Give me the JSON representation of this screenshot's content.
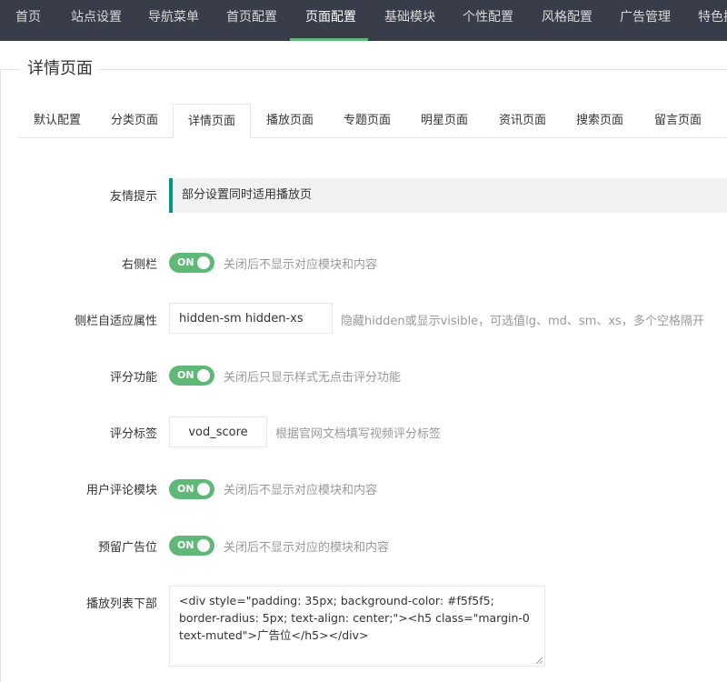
{
  "topnav": {
    "items": [
      "首页",
      "站点设置",
      "导航菜单",
      "首页配置",
      "页面配置",
      "基础模块",
      "个性配置",
      "风格配置",
      "广告管理",
      "特色插件"
    ],
    "active_index": 4,
    "active_color": "#5fb878"
  },
  "section": {
    "legend": "详情页面"
  },
  "tabs": {
    "items": [
      "默认配置",
      "分类页面",
      "详情页面",
      "播放页面",
      "专题页面",
      "明星页面",
      "资讯页面",
      "搜索页面",
      "留言页面"
    ],
    "active_index": 2
  },
  "form": {
    "tip": {
      "label": "友情提示",
      "text": "部分设置同时适用播放页",
      "accent": "#009688"
    },
    "right_sidebar": {
      "label": "右侧栏",
      "switch": "ON",
      "hint": "关闭后不显示对应模块和内容"
    },
    "sidebar_responsive": {
      "label": "侧栏自适应属性",
      "value": "hidden-sm hidden-xs",
      "hint": "隐藏hidden或显示visible，可选值lg、md、sm、xs，多个空格隔开"
    },
    "rating": {
      "label": "评分功能",
      "switch": "ON",
      "hint": "关闭后只显示样式无点击评分功能"
    },
    "rating_tag": {
      "label": "评分标签",
      "value": "vod_score",
      "hint": "根据官网文档填写视频评分标签"
    },
    "comments": {
      "label": "用户评论模块",
      "switch": "ON",
      "hint": "关闭后不显示对应模块和内容"
    },
    "reserved_ad": {
      "label": "预留广告位",
      "switch": "ON",
      "hint": "关闭后不显示对应的模块和内容"
    },
    "playlist_bottom": {
      "label": "播放列表下部",
      "value": "<div style=\"padding: 35px; background-color: #f5f5f5; border-radius: 5px; text-align: center;\"><h5 class=\"margin-0 text-muted\">广告位</h5></div>"
    }
  },
  "colors": {
    "switch_on": "#5fb878",
    "nav_bg": "#393d49"
  },
  "icons": {
    "resize": "resize-grip-icon"
  }
}
